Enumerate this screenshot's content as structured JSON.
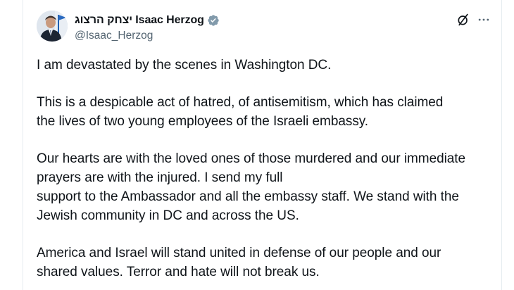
{
  "author": {
    "display_name": "יצחק הרצוג Isaac Herzog",
    "handle": "@Isaac_Herzog",
    "verified": true,
    "verified_color": "#829aab",
    "avatar_desc": "avatar-photo"
  },
  "actions": {
    "grok_icon": "grok-icon",
    "more_icon": "more-icon"
  },
  "tweet": {
    "paragraphs": [
      [
        "I am devastated by the scenes in Washington DC."
      ],
      [
        "This is a despicable act of hatred, of antisemitism, which has claimed",
        "the lives of two young employees of the Israeli embassy."
      ],
      [
        "Our hearts are with the loved ones of those murdered and our immediate",
        "prayers are with the injured. I send my full",
        "support to the Ambassador and all the embassy staff. We stand with the",
        "Jewish community in DC and across the US."
      ],
      [
        "America and Israel will stand united in defense of our people and our",
        "shared values. Terror and hate will not break us."
      ]
    ]
  },
  "colors": {
    "text": "#0f1419",
    "secondary": "#536471",
    "border": "#e6ecf0"
  }
}
